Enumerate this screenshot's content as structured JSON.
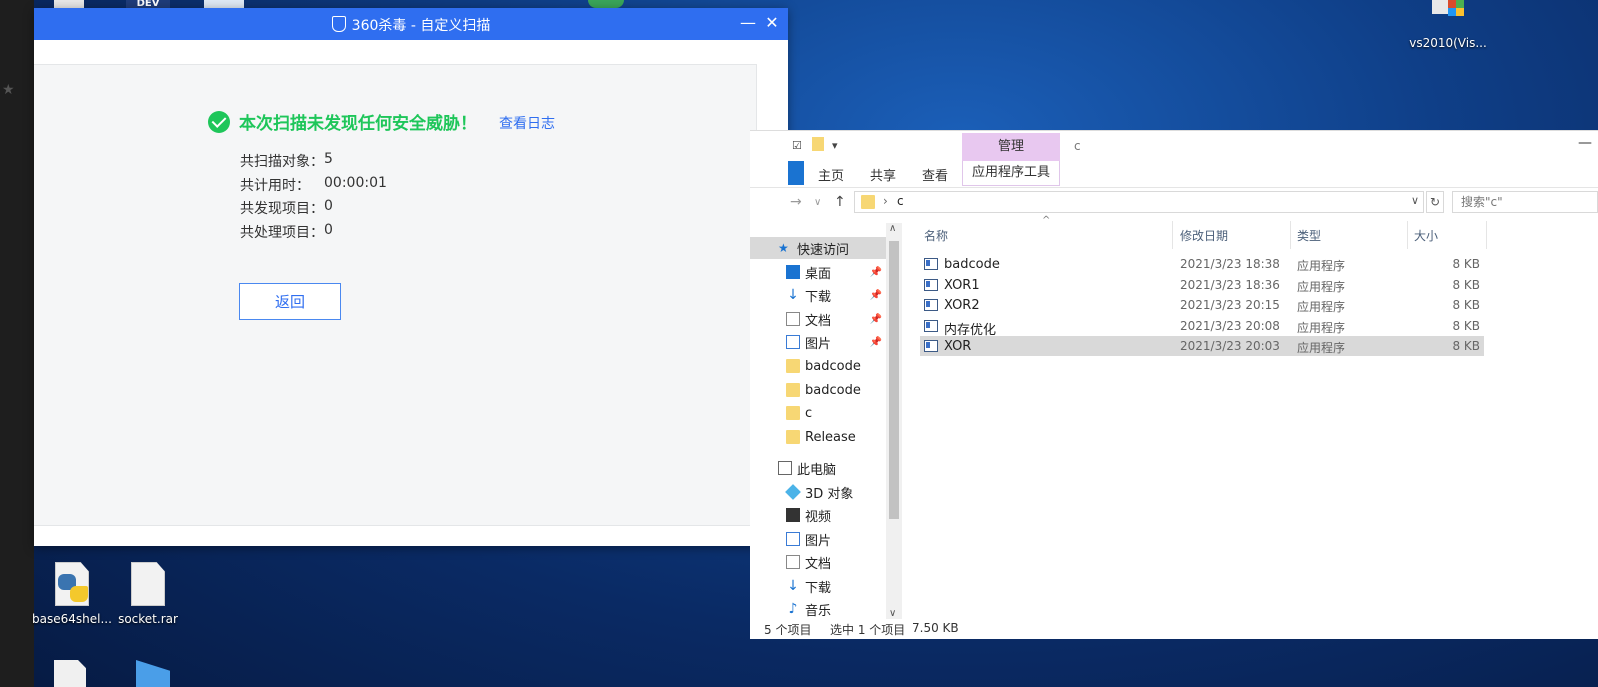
{
  "desktop": {
    "icons": [
      {
        "label": "vs2010(Vis..."
      },
      {
        "label": "base64shel..."
      },
      {
        "label": "socket.rar"
      }
    ],
    "top_partial_label": "DEV"
  },
  "scanner": {
    "title": "360杀毒 - 自定义扫描",
    "minimize": "—",
    "close": "✕",
    "result_text": "本次扫描未发现任何安全威胁！",
    "view_log": "查看日志",
    "stats": [
      {
        "key": "共扫描对象：",
        "value": "5"
      },
      {
        "key": "共计用时：",
        "value": "00:00:01"
      },
      {
        "key": "共发现项目：",
        "value": "0"
      },
      {
        "key": "共处理项目：",
        "value": "0"
      }
    ],
    "back_button": "返回",
    "colors": {
      "brand": "#2f6ef0",
      "success": "#1ec65a"
    }
  },
  "explorer": {
    "window_title": "c",
    "manage_tab": "管理",
    "tabs": {
      "home": "主页",
      "share": "共享",
      "view": "查看",
      "app_tools": "应用程序工具"
    },
    "address": {
      "segment": "c"
    },
    "search_placeholder": "搜索\"c\"",
    "columns": {
      "name": "名称",
      "date": "修改日期",
      "type": "类型",
      "size": "大小"
    },
    "nav": {
      "quick_access": "快速访问",
      "items": [
        {
          "label": "桌面",
          "pinned": true
        },
        {
          "label": "下载",
          "pinned": true
        },
        {
          "label": "文档",
          "pinned": true
        },
        {
          "label": "图片",
          "pinned": true
        },
        {
          "label": "badcode",
          "pinned": false
        },
        {
          "label": "badcode",
          "pinned": false
        },
        {
          "label": "c",
          "pinned": false
        },
        {
          "label": "Release",
          "pinned": false
        }
      ],
      "this_pc": "此电脑",
      "pc_items": [
        {
          "label": "3D 对象"
        },
        {
          "label": "视频"
        },
        {
          "label": "图片"
        },
        {
          "label": "文档"
        },
        {
          "label": "下载"
        },
        {
          "label": "音乐"
        }
      ]
    },
    "files": [
      {
        "name": "badcode",
        "date": "2021/3/23 18:38",
        "type": "应用程序",
        "size": "8 KB",
        "selected": false
      },
      {
        "name": "XOR1",
        "date": "2021/3/23 18:36",
        "type": "应用程序",
        "size": "8 KB",
        "selected": false
      },
      {
        "name": "XOR2",
        "date": "2021/3/23 20:15",
        "type": "应用程序",
        "size": "8 KB",
        "selected": false
      },
      {
        "name": "内存优化",
        "date": "2021/3/23 20:08",
        "type": "应用程序",
        "size": "8 KB",
        "selected": false
      },
      {
        "name": "XOR",
        "date": "2021/3/23 20:03",
        "type": "应用程序",
        "size": "8 KB",
        "selected": true
      }
    ],
    "status": {
      "count": "5 个项目",
      "selection": "选中 1 个项目",
      "sel_size": "7.50 KB"
    }
  }
}
